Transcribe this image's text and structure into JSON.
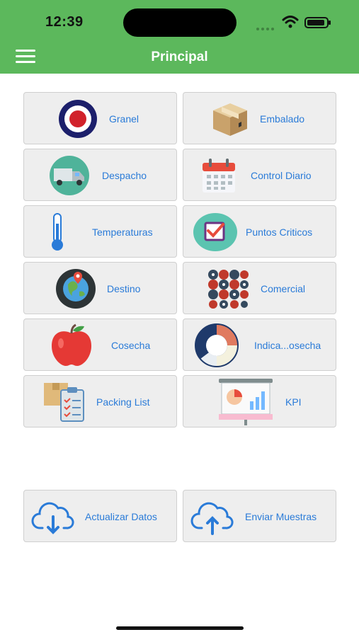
{
  "status": {
    "time": "12:39"
  },
  "header": {
    "title": "Principal"
  },
  "tiles": [
    {
      "label": "Granel",
      "icon": "ring-target-icon"
    },
    {
      "label": "Embalado",
      "icon": "box-icon"
    },
    {
      "label": "Despacho",
      "icon": "truck-icon"
    },
    {
      "label": "Control Diario",
      "icon": "calendar-icon"
    },
    {
      "label": "Temperaturas",
      "icon": "thermometer-icon"
    },
    {
      "label": "Puntos Criticos",
      "icon": "checkbox-icon"
    },
    {
      "label": "Destino",
      "icon": "globe-pin-icon"
    },
    {
      "label": "Comercial",
      "icon": "grid-dots-icon"
    },
    {
      "label": "Cosecha",
      "icon": "apple-icon"
    },
    {
      "label": "Indica...osecha",
      "icon": "donut-chart-icon"
    },
    {
      "label": "Packing List",
      "icon": "clipboard-box-icon"
    },
    {
      "label": "KPI",
      "icon": "presentation-chart-icon"
    }
  ],
  "actions": [
    {
      "label": "Actualizar Datos",
      "icon": "cloud-download-icon"
    },
    {
      "label": "Enviar Muestras",
      "icon": "cloud-upload-icon"
    }
  ],
  "colors": {
    "accent": "#5cb85c",
    "link": "#2a7bd8",
    "tile": "#eeeeee"
  }
}
